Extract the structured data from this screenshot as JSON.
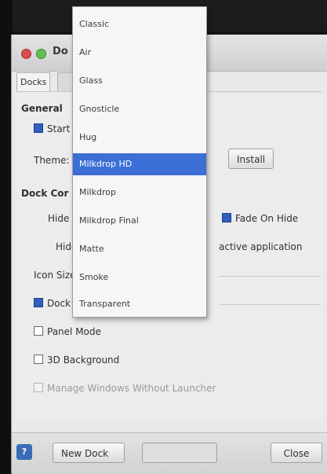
{
  "window": {
    "title": "Do"
  },
  "tabs": [
    {
      "label": "Docks"
    },
    {
      "label": ""
    }
  ],
  "general": {
    "header": "General",
    "start_label": "Start",
    "theme_label": "Theme:",
    "install_label": "Install"
  },
  "dock_config": {
    "header": "Dock Cor",
    "mode_label": "Hide",
    "fade_label": "Fade On Hide",
    "mode2_label": "Hide",
    "active_app_label": "active application",
    "icon_size_label": "Icon Size"
  },
  "options": {
    "dock_item": "Dock",
    "panel_mode": "Panel Mode",
    "background_3d": "3D Background",
    "manage_windows": "Manage Windows Without Launcher"
  },
  "bottom": {
    "new_dock_label": "New Dock",
    "disabled_label": "",
    "close_label": "Close"
  },
  "menu": {
    "items": [
      "Classic",
      "Air",
      "Glass",
      "Gnosticle",
      "Hug",
      "Milkdrop HD",
      "Milkdrop",
      "Milkdrop Final",
      "Matte",
      "Smoke",
      "Transparent"
    ],
    "selected_index": 5
  },
  "colors": {
    "selection": "#3c6fd6",
    "accent": "#2f5fbf"
  }
}
